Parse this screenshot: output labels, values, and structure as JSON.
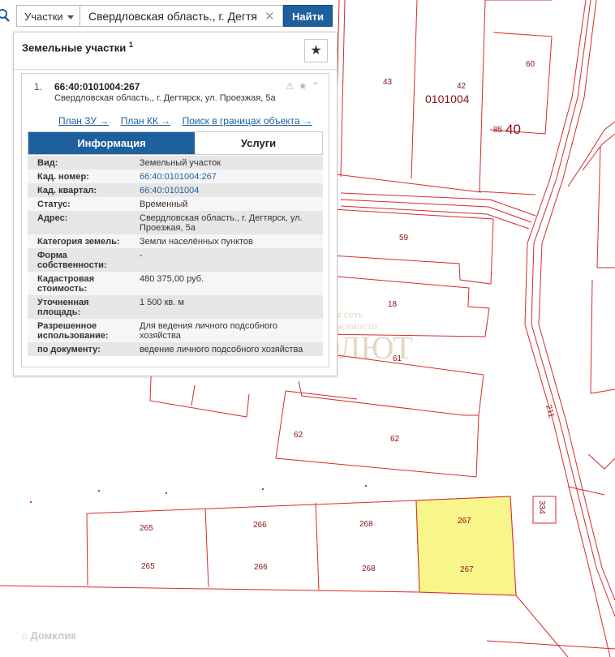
{
  "search": {
    "type_label": "Участки",
    "query": "Свердловская область., г. Дегтя",
    "clear_glyph": "✕",
    "find_label": "Найти"
  },
  "panel": {
    "title": "Земельные участки",
    "title_count": "1",
    "fav_glyph": "★"
  },
  "card": {
    "index": "1.",
    "cad_number": "66:40:0101004:267",
    "address": "Свердловская область., г. Дегтярск, ул. Проезжая, 5а",
    "links": [
      "План ЗУ →",
      "План КК →",
      "Поиск в границах объекта →"
    ],
    "tabs": [
      "Информация",
      "Услуги"
    ],
    "rows": [
      {
        "key": "Вид:",
        "value": "Земельный участок"
      },
      {
        "key": "Кад. номер:",
        "value": "66:40:0101004:267"
      },
      {
        "key": "Кад. квартал:",
        "value": "66:40:0101004"
      },
      {
        "key": "Статус:",
        "value": "Временный"
      },
      {
        "key": "Адрес:",
        "value": "Свердловская область., г. Дегтярск, ул. Проезжая, 5а"
      },
      {
        "key": "Категория земель:",
        "value": "Земли населённых пунктов"
      },
      {
        "key": "Форма собственности:",
        "value": "-"
      },
      {
        "key": "Кадастровая стоимость:",
        "value": "480 375,00 руб."
      },
      {
        "key": "Уточненная площадь:",
        "value": "1 500 кв. м"
      },
      {
        "key": "Разрешенное использование:",
        "value": "Для ведения личного подсобного хозяйства"
      },
      {
        "key": "по документу:",
        "value": "ведение личного подсобного хозяйства"
      }
    ]
  },
  "map": {
    "quarter_label": "0101004",
    "plot_labels": [
      "43",
      "42",
      "60",
      "85",
      "40",
      "59",
      "18",
      "61",
      "62",
      "62",
      "265",
      "266",
      "268",
      "267",
      "265",
      "266",
      "268",
      "267",
      "334",
      "211"
    ],
    "highlight_color": "#f8f58a",
    "boundary_color": "#c8102e"
  },
  "watermark": {
    "line1": "Региональная сеть",
    "line2": "агентств недвижимости",
    "brand": "АБСОЛЮТ"
  },
  "footer": {
    "brand": "Домклик"
  }
}
